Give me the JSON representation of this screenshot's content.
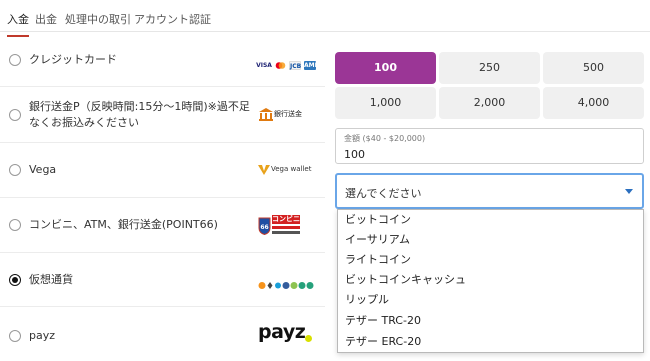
{
  "tabs": [
    {
      "label": "入金"
    },
    {
      "label": "出金"
    },
    {
      "label": "処理中の取引"
    },
    {
      "label": "アカウント認証"
    }
  ],
  "methods": [
    {
      "label": "クレジットカード",
      "logo": "visa-mastercard-jcb-amex-logos",
      "selected": false
    },
    {
      "label": "銀行送金P（反映時間:15分～1時間)※過不足なくお振込みください",
      "logo_text": "銀行送金",
      "selected": false
    },
    {
      "label": "Vega",
      "logo_text": "Vega wallet",
      "selected": false
    },
    {
      "label": "コンビニ、ATM、銀行送金(POINT66)",
      "logo_text": "コンビニ",
      "selected": false
    },
    {
      "label": "仮想通貨",
      "logo": "crypto-coin-icons",
      "selected": true
    },
    {
      "label": "payz",
      "logo_text": "payz",
      "selected": false
    }
  ],
  "card_logos": [
    "VISA",
    "MC",
    "JCB",
    "AMEX"
  ],
  "amounts": [
    "100",
    "250",
    "500",
    "1,000",
    "2,000",
    "4,000"
  ],
  "selected_amount": "100",
  "amount_field": {
    "label": "金額 ($40 - $20,000)",
    "value": "100"
  },
  "currency_select": {
    "value": "選んでください"
  },
  "currency_options": [
    "ビットコイン",
    "イーサリアム",
    "ライトコイン",
    "ビットコインキャッシュ",
    "リップル",
    "テザー TRC-20",
    "テザー ERC-20"
  ],
  "colors": {
    "accent": "#9b3696",
    "active_tab": "#c0392b",
    "focus": "#6aa6e8"
  }
}
